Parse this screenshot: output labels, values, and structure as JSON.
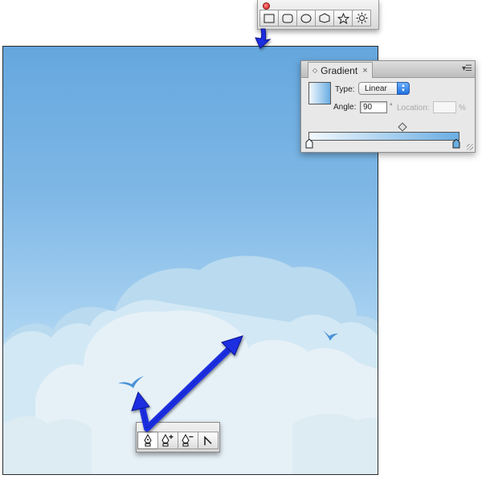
{
  "colors": {
    "sky_top": "#65a7de",
    "sky_bottom": "#cfe6f8",
    "cloud_light": "#e9f3f8",
    "cloud_mid": "#c6e0f1",
    "bird": "#4a93d8",
    "arrow": "#1a2fe0",
    "ramp_start": "#f2f8fe",
    "ramp_end": "#6aaee3"
  },
  "shape_panel": {
    "tools": [
      {
        "icon": "rectangle-icon"
      },
      {
        "icon": "rounded-rectangle-icon"
      },
      {
        "icon": "ellipse-icon"
      },
      {
        "icon": "polygon-icon"
      },
      {
        "icon": "star-icon"
      },
      {
        "icon": "flare-icon"
      }
    ]
  },
  "gradient_panel": {
    "tab_title": "Gradient",
    "tab_close": "×",
    "type_label": "Type:",
    "type_value": "Linear",
    "angle_label": "Angle:",
    "angle_value": "90",
    "angle_unit": "°",
    "location_label": "Location:",
    "location_unit": "%"
  },
  "pen_panel": {
    "tools": [
      {
        "icon": "pen-icon"
      },
      {
        "icon": "add-anchor-point-icon",
        "symbol": "+"
      },
      {
        "icon": "delete-anchor-point-icon",
        "symbol": "−"
      },
      {
        "icon": "convert-anchor-point-icon"
      }
    ]
  }
}
